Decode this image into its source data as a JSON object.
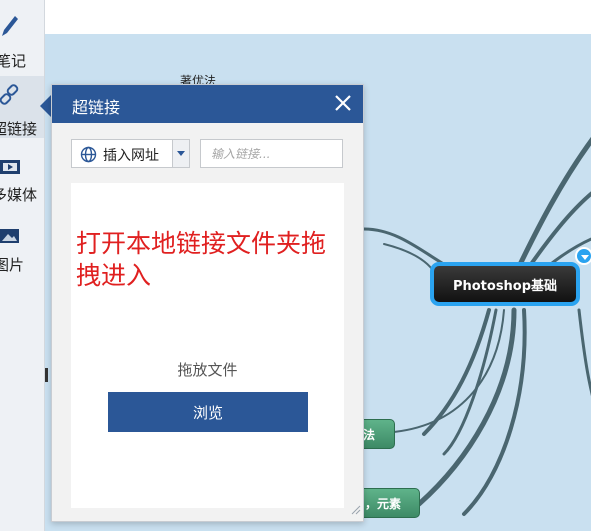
{
  "sidebar": {
    "items": [
      {
        "label": "笔记",
        "icon": "pencil-icon"
      },
      {
        "label": "超链接",
        "icon": "link-icon"
      },
      {
        "label": "多媒体",
        "icon": "film-icon"
      },
      {
        "label": "图片",
        "icon": "image-icon"
      }
    ]
  },
  "mindmap": {
    "central_topic": "Photoshop基础",
    "partial_topics": [
      "法",
      "，元素"
    ],
    "partial_text": "著优法"
  },
  "hyperlink_panel": {
    "title": "超链接",
    "insert_button_label": "插入网址",
    "link_input_placeholder": "输入链接...",
    "drop_note": "打开本地链接文件夹拖拽进入",
    "drop_label": "拖放文件",
    "browse_label": "浏览"
  },
  "colors": {
    "panel_header": "#2b5797",
    "canvas_bg": "#c9e0f0",
    "central_border": "#2aa3f0",
    "drop_note": "#e02020",
    "topic_green": "#4a9e78"
  }
}
